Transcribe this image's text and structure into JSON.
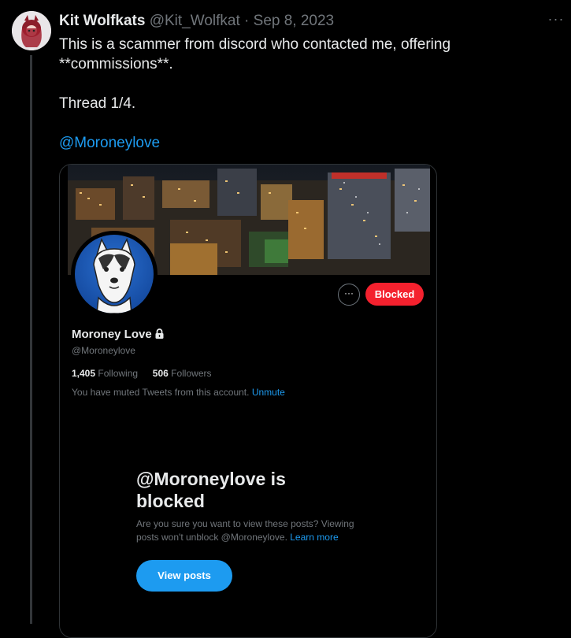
{
  "tweet": {
    "author_name": "Kit Wolfkats",
    "author_handle": "@Kit_Wolfkat",
    "separator": "·",
    "date": "Sep 8, 2023",
    "more_label": "···",
    "text_line1": "This is a scammer from discord who contacted me, offering **commissions**.",
    "text_line2": "Thread 1/4.",
    "mention": "@Moroneylove"
  },
  "profile": {
    "name": "Moroney Love",
    "handle": "@Moroneylove",
    "following_count": "1,405",
    "following_label": "Following",
    "followers_count": "506",
    "followers_label": "Followers",
    "muted_text": "You have muted Tweets from this account.",
    "unmute_label": "Unmute",
    "more_label": "···",
    "blocked_label": "Blocked"
  },
  "blocked_notice": {
    "title": "@Moroneylove is blocked",
    "description": "Are you sure you want to view these posts? Viewing posts won't unblock @Moroneylove.",
    "learn_more": "Learn more",
    "view_posts_label": "View posts"
  },
  "colors": {
    "accent": "#1d9bf0",
    "blocked": "#f4212e",
    "background": "#000000"
  },
  "icons": [
    "avatar",
    "more-horizontal-icon",
    "lock-icon",
    "wolf-avatar"
  ]
}
